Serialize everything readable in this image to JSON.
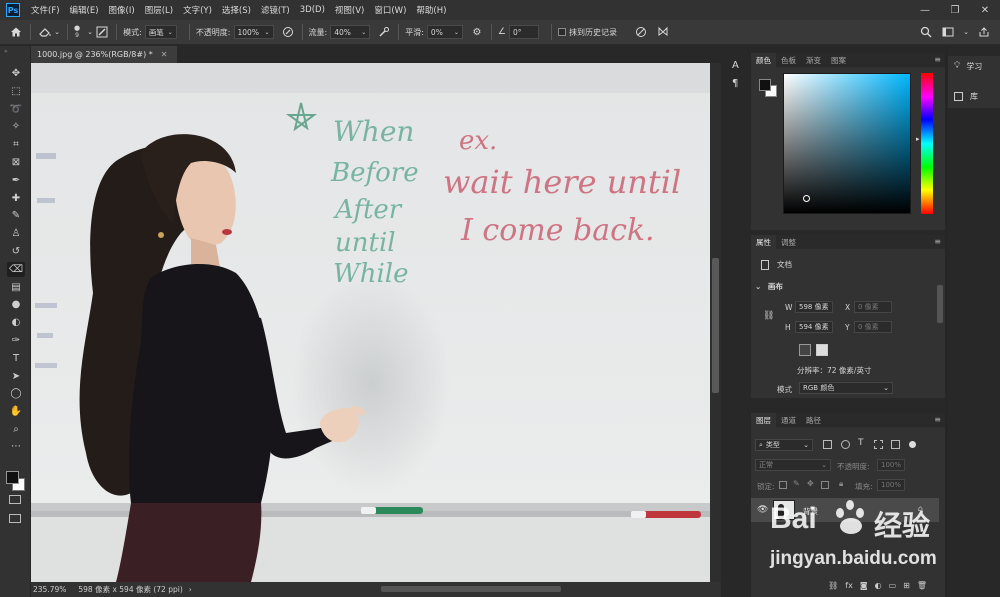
{
  "app": {
    "logo": "Ps"
  },
  "menu": [
    "文件(F)",
    "编辑(E)",
    "图像(I)",
    "图层(L)",
    "文字(Y)",
    "选择(S)",
    "滤镜(T)",
    "3D(D)",
    "视图(V)",
    "窗口(W)",
    "帮助(H)"
  ],
  "window_controls": {
    "minimize": "—",
    "maximize": "❐",
    "close": "✕"
  },
  "options": {
    "brush_size": "9",
    "mode_label": "模式:",
    "mode_value": "画笔",
    "opacity_label": "不透明度:",
    "opacity_value": "100%",
    "flow_label": "流量:",
    "flow_value": "40%",
    "smooth_label": "平滑:",
    "smooth_value": "0%",
    "angle_value": "0°",
    "history_label": "抹到历史记录"
  },
  "document": {
    "tab_title": "1000.jpg @ 236%(RGB/8#) *",
    "zoom": "235.79%",
    "doc_info": "598 像素 x 594 像素 (72 ppi)"
  },
  "photo_text": {
    "line1": "When",
    "line2": "Before",
    "line3": "After",
    "line4": "until",
    "line5": "While",
    "ex": "ex.",
    "wait": "wait here until",
    "come": "I come back."
  },
  "color_panel": {
    "tabs": [
      "颜色",
      "色板",
      "渐变",
      "图案"
    ],
    "foreground": "#111111",
    "background": "#ffffff",
    "base_hue": "#00b7ff"
  },
  "properties_panel": {
    "tabs": [
      "属性",
      "调整"
    ],
    "doc_label": "文档",
    "section": "画布",
    "w_label": "W",
    "w_value": "598 像素",
    "h_label": "H",
    "h_value": "594 像素",
    "x_label": "X",
    "x_placeholder": "0 像素",
    "y_label": "Y",
    "y_placeholder": "0 像素",
    "resolution": "分辨率：72 像素/英寸",
    "mode_label": "模式",
    "mode_value": "RGB 颜色"
  },
  "layers_panel": {
    "tabs": [
      "图层",
      "通道",
      "路径"
    ],
    "search_placeholder": "类型",
    "blend_mode": "正常",
    "opacity_label": "不透明度:",
    "opacity_value": "100%",
    "lock_label": "锁定:",
    "fill_label": "填充:",
    "fill_value": "100%",
    "layer_name": "背景"
  },
  "learn_panel": {
    "learn": "学习",
    "library": "库"
  },
  "watermark": {
    "brand_left": "Bai",
    "brand_right": "经验",
    "url": "jingyan.baidu.com"
  },
  "tools": [
    "move-tool",
    "marquee-tool",
    "lasso-tool",
    "magic-wand-tool",
    "crop-tool",
    "frame-tool",
    "eyedropper-tool",
    "healing-tool",
    "brush-tool",
    "stamp-tool",
    "history-brush-tool",
    "eraser-tool",
    "gradient-tool",
    "blur-tool",
    "dodge-tool",
    "pen-tool",
    "type-tool",
    "path-select-tool",
    "shape-tool",
    "hand-tool",
    "zoom-tool",
    "more-tool"
  ]
}
